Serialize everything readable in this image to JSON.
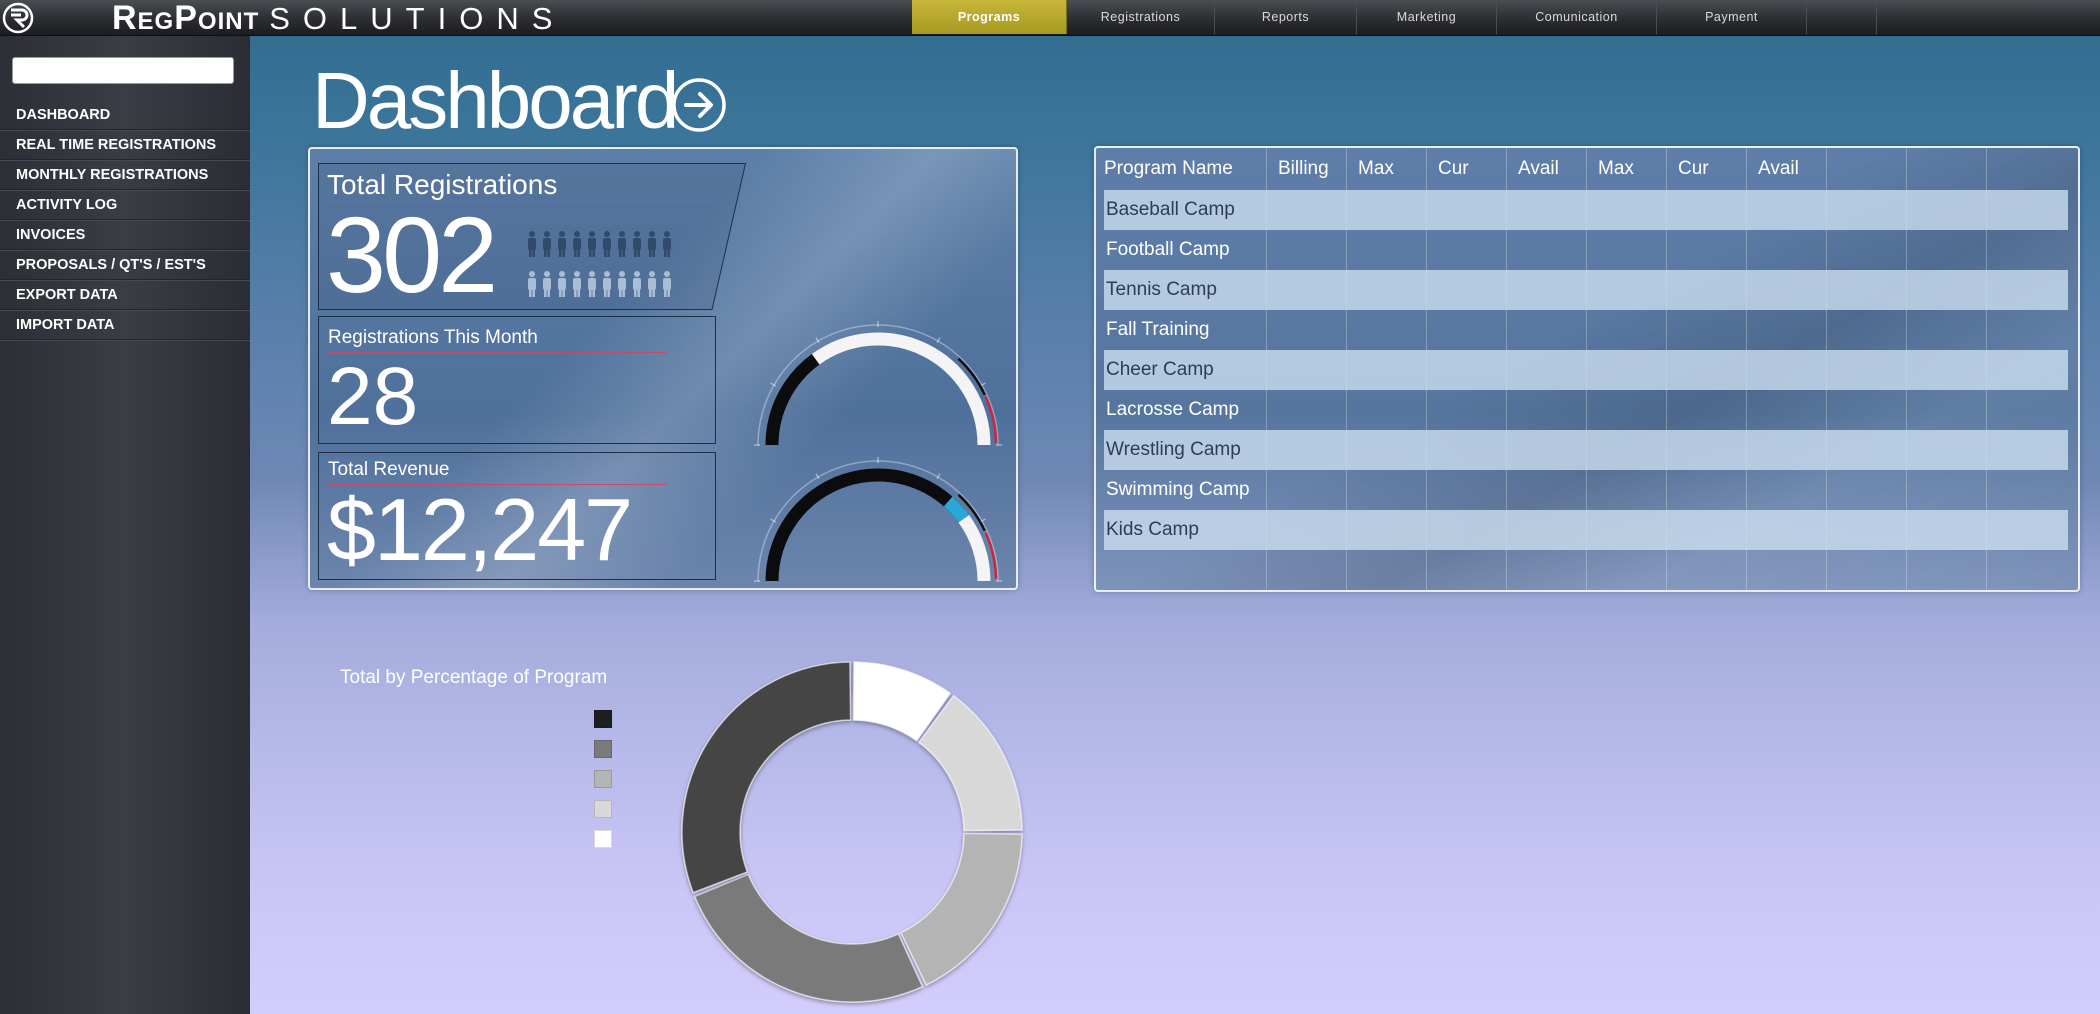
{
  "brand": {
    "name_bold": "RegPoint",
    "name_light": "SOLUTIONS"
  },
  "nav": [
    {
      "label": "Programs",
      "active": true
    },
    {
      "label": "Registrations",
      "active": false
    },
    {
      "label": "Reports",
      "active": false
    },
    {
      "label": "Marketing",
      "active": false
    },
    {
      "label": "Comunication",
      "active": false
    },
    {
      "label": "Payment",
      "active": false
    },
    {
      "label": "",
      "active": false
    }
  ],
  "sidebar": {
    "search": {
      "value": "",
      "placeholder": ""
    },
    "items": [
      {
        "label": "DASHBOARD"
      },
      {
        "label": "REAL TIME REGISTRATIONS"
      },
      {
        "label": "MONTHLY REGISTRATIONS"
      },
      {
        "label": "ACTIVITY LOG"
      },
      {
        "label": "INVOICES"
      },
      {
        "label": "PROPOSALS / QT'S / EST'S"
      },
      {
        "label": "EXPORT DATA"
      },
      {
        "label": "IMPORT DATA"
      }
    ]
  },
  "page": {
    "title": "Dashboard"
  },
  "stats": {
    "total_registrations": {
      "label": "Total Registrations",
      "value": "302"
    },
    "registrations_month": {
      "label": "Registrations This Month",
      "value": "28"
    },
    "total_revenue": {
      "label": "Total Revenue",
      "value": "$12,247"
    },
    "people_icons": {
      "dark_count": 10,
      "light_count": 10
    },
    "gauges": [
      {
        "name": "registrations-gauge",
        "fraction": 0.3
      },
      {
        "name": "revenue-gauge",
        "fraction": 0.8
      }
    ]
  },
  "program_table": {
    "columns": [
      "Program Name",
      "Billing",
      "Max",
      "Cur",
      "Avail",
      "Max",
      "Cur",
      "Avail",
      "",
      "",
      ""
    ],
    "rows": [
      {
        "name": "Baseball Camp"
      },
      {
        "name": "Football Camp"
      },
      {
        "name": "Tennis Camp"
      },
      {
        "name": "Fall Training"
      },
      {
        "name": "Cheer Camp"
      },
      {
        "name": "Lacrosse Camp"
      },
      {
        "name": "Wrestling Camp"
      },
      {
        "name": "Swimming Camp"
      },
      {
        "name": "Kids Camp"
      }
    ]
  },
  "donut": {
    "title": "Total by Percentage of Program",
    "colors": {
      "black": "#1f1f1f",
      "darkgray": "#7a7a7a",
      "gray": "#b4b4b4",
      "lightgray": "#d8d8d8",
      "white": "#ffffff"
    },
    "legend": [
      {
        "color": "#1f1f1f",
        "label": ""
      },
      {
        "color": "#7a7a7a",
        "label": ""
      },
      {
        "color": "#b4b4b4",
        "label": ""
      },
      {
        "color": "#d8d8d8",
        "label": ""
      },
      {
        "color": "#ffffff",
        "label": ""
      }
    ]
  },
  "chart_data": {
    "type": "pie",
    "title": "Total by Percentage of Program",
    "categories": [
      "",
      "",
      "",
      "",
      ""
    ],
    "values": [
      10,
      15,
      18,
      26,
      31
    ],
    "colors": [
      "#ffffff",
      "#d8d8d8",
      "#b4b4b4",
      "#7a7a7a",
      "#444444"
    ],
    "donut": true
  }
}
